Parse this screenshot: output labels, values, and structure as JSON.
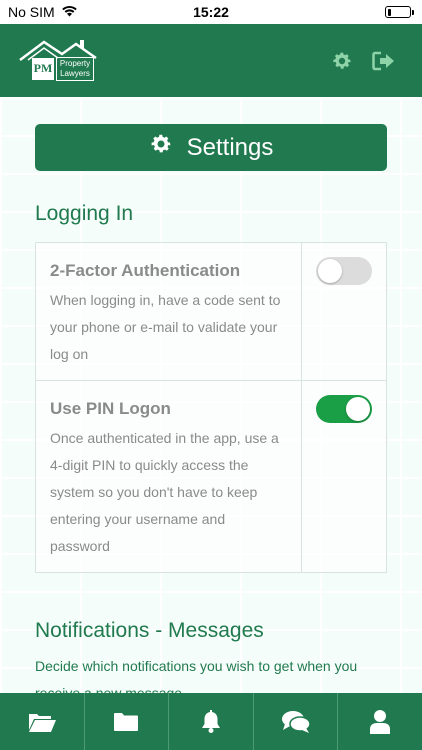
{
  "status_bar": {
    "carrier": "No SIM",
    "time": "15:22",
    "battery_level": 0.15
  },
  "header": {
    "logo": {
      "initials": "PM",
      "line1": "Property",
      "line2": "Lawyers"
    },
    "icons": [
      "gear-icon",
      "sign-out-icon"
    ]
  },
  "page": {
    "title": "Settings",
    "title_icon": "gear-icon"
  },
  "sections": {
    "logging_in": {
      "title": "Logging In",
      "items": [
        {
          "title": "2-Factor Authentication",
          "description": "When logging in, have a code sent to your phone or e-mail to validate your log on",
          "enabled": false
        },
        {
          "title": "Use PIN Logon",
          "description": "Once authenticated in the app, use a 4-digit PIN to quickly access the system so you don't have to keep entering your username and password",
          "enabled": true
        }
      ]
    },
    "notifications_messages": {
      "title": "Notifications - Messages",
      "description": "Decide which notifications you wish to get when you receive a new message"
    }
  },
  "bottom_nav": {
    "items": [
      "folder-open-icon",
      "folder-icon",
      "bell-icon",
      "chat-bubbles-icon",
      "user-icon"
    ]
  },
  "colors": {
    "brand": "#217a4f",
    "toggle_on": "#1a9e46",
    "toggle_off": "#dcdcdc",
    "muted_text": "#8a8a8a"
  }
}
